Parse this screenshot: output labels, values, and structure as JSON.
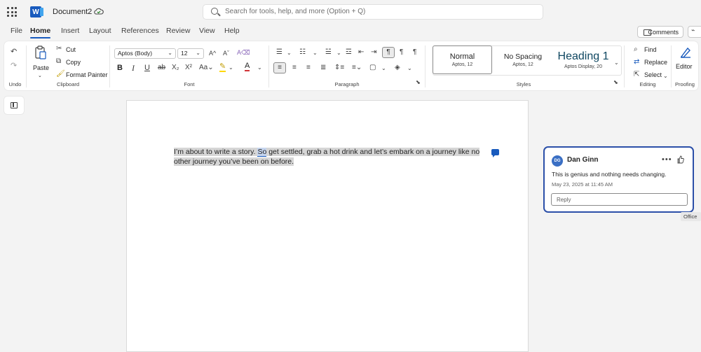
{
  "app": {
    "doc_title": "Document2",
    "search_placeholder": "Search for tools, help, and more (Option + Q)",
    "brand_color": "#185abd"
  },
  "menu": {
    "items": [
      "File",
      "Home",
      "Insert",
      "Layout",
      "References",
      "Review",
      "View",
      "Help"
    ],
    "active": "Home",
    "comments_label": "Comments"
  },
  "ribbon": {
    "undo_group": "Undo",
    "clipboard": {
      "paste": "Paste",
      "cut": "Cut",
      "copy": "Copy",
      "format_painter": "Format Painter",
      "label": "Clipboard"
    },
    "font": {
      "family": "Aptos (Body)",
      "size": "12",
      "label": "Font",
      "grow": "A^",
      "shrink": "Aˇ"
    },
    "paragraph": {
      "label": "Paragraph"
    },
    "styles": {
      "label": "Styles",
      "items": [
        {
          "name": "Normal",
          "sub": "Aptos, 12"
        },
        {
          "name": "No Spacing",
          "sub": "Aptos, 12"
        },
        {
          "name": "Heading 1",
          "sub": "Aptos Display, 20"
        }
      ]
    },
    "editing": {
      "find": "Find",
      "replace": "Replace",
      "select": "Select",
      "label": "Editing"
    },
    "proofing": {
      "editor": "Editor",
      "label": "Proofing"
    }
  },
  "document": {
    "text_before": "I’m about to write a story. ",
    "text_word": "So",
    "text_after": " get settled, grab a hot drink and let’s embark on a journey like no other journey you’ve been on before."
  },
  "comment": {
    "initials": "DG",
    "author": "Dan Ginn",
    "text": "This is genius and nothing needs changing.",
    "date": "May 23, 2025 at 11:45 AM",
    "reply_placeholder": "Reply",
    "tooltip": "Office"
  }
}
